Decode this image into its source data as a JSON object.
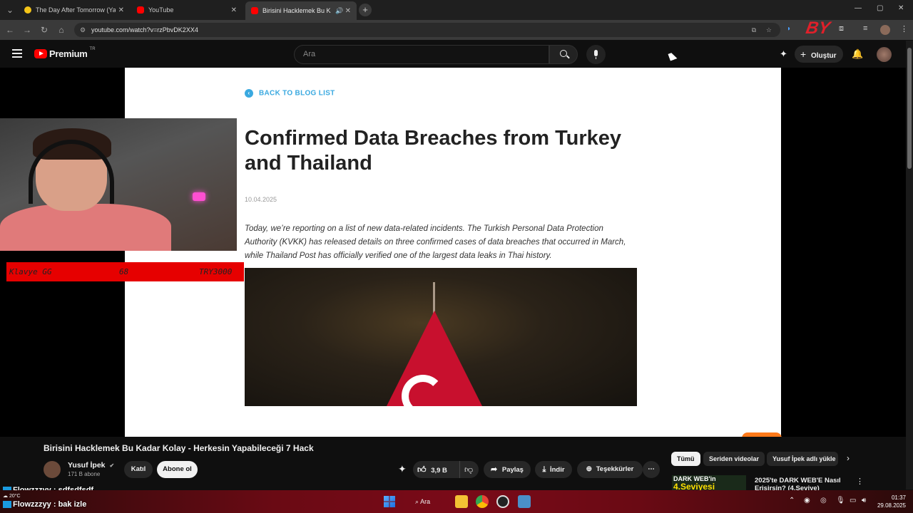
{
  "browser": {
    "tabs": [
      {
        "label": "The Day After Tomorrow (Yarın",
        "color": "#f5c518"
      },
      {
        "label": "YouTube",
        "color": "#ff0000"
      },
      {
        "label": "Birisini Hacklemek Bu Kada",
        "color": "#ff0000",
        "active": true
      }
    ],
    "url": "youtube.com/watch?v=rzPbvDK2XX4"
  },
  "youtube": {
    "logo_text": "Premium",
    "logo_region": "TR",
    "search_placeholder": "Ara",
    "create_label": "Oluştur"
  },
  "blog": {
    "back_link": "BACK TO BLOG LIST",
    "title": "Confirmed Data Breaches from Turkey and Thailand",
    "date": "10.04.2025",
    "body": "Today, we’re reporting on a list of new data-related incidents. The Turkish Personal Data Protection Authority (KVKK) has released details on three confirmed cases of data breaches that occurred in March, while Thailand Post has officially verified one of the largest data leaks in Thai history."
  },
  "stream_overlay": {
    "label": "Klavye GG",
    "count": "68",
    "goal": "TRY3000",
    "watermark": "BY"
  },
  "video": {
    "title": "Birisini Hacklemek Bu Kadar Kolay - Herkesin Yapabileceği 7 Hack",
    "channel": "Yusuf İpek",
    "subscribers": "171 B abone",
    "join_label": "Katıl",
    "subscribe_label": "Abone ol",
    "likes": "3,9 B",
    "share_label": "Paylaş",
    "download_label": "İndir",
    "thanks_label": "Teşekkürler"
  },
  "chips": [
    "Tümü",
    "Seriden videolar",
    "Yusuf İpek adlı yükle"
  ],
  "recommendation": {
    "thumb_text_1": "DARK WEB'in",
    "thumb_text_2": "4.Seviyesi",
    "title": "2025'te DARK WEB'E Nasıl Erişirsin? (4.Seviye)"
  },
  "chat": [
    {
      "user": "Flowzzzyy",
      "message": ": sdfsdfsdf,"
    },
    {
      "user": "Flowzzzyy",
      "message": ": bak izle"
    }
  ],
  "taskbar": {
    "search_label": "Ara",
    "weather": "20°C",
    "time": "01:37",
    "date": "29.08.2025"
  }
}
